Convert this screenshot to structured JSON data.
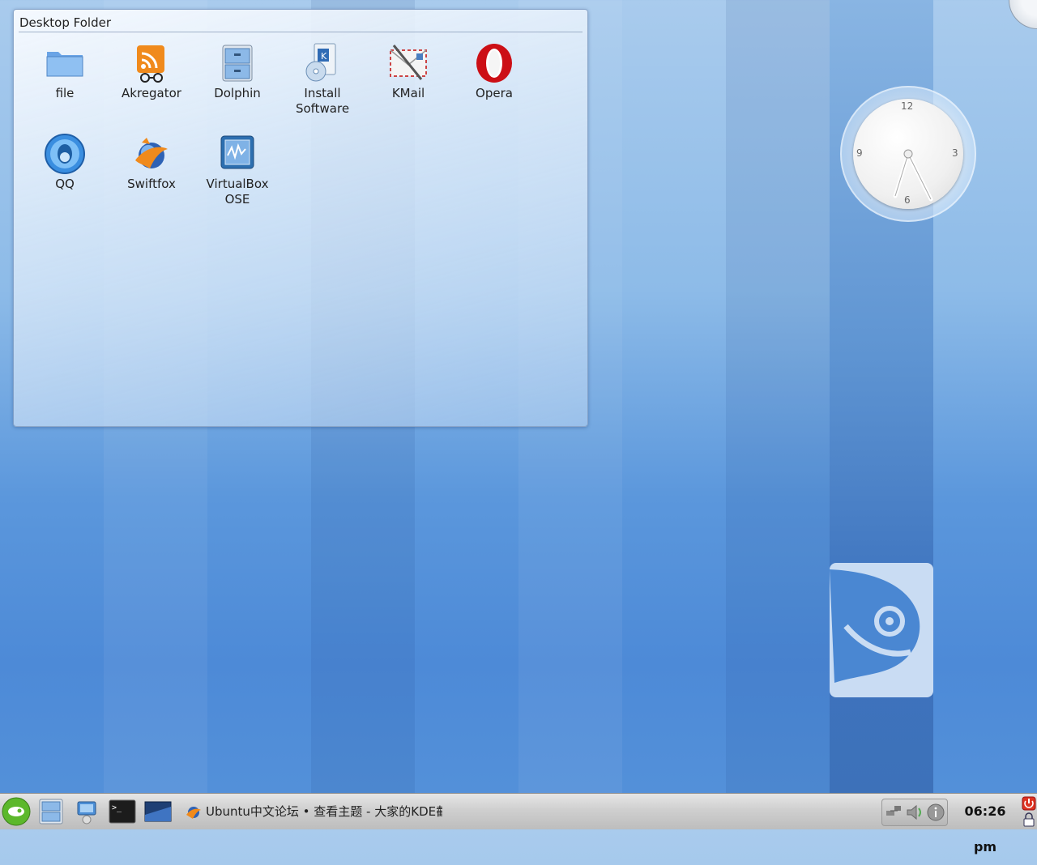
{
  "folder": {
    "title": "Desktop Folder",
    "items": [
      {
        "label": "file",
        "icon": "folder-icon"
      },
      {
        "label": "Akregator",
        "icon": "akregator-icon"
      },
      {
        "label": "Dolphin",
        "icon": "dolphin-icon"
      },
      {
        "label": "Install\nSoftware",
        "icon": "install-software-icon"
      },
      {
        "label": "KMail",
        "icon": "kmail-icon"
      },
      {
        "label": "Opera",
        "icon": "opera-icon"
      },
      {
        "label": "QQ",
        "icon": "qq-icon"
      },
      {
        "label": "Swiftfox",
        "icon": "swiftfox-icon"
      },
      {
        "label": "VirtualBox\nOSE",
        "icon": "virtualbox-icon"
      }
    ]
  },
  "clock_widget": {
    "numerals": {
      "twelve": "12",
      "three": "3",
      "six": "6",
      "nine": "9"
    }
  },
  "taskbar": {
    "task_title": "Ubuntu中文论坛 • 查看主题 - 大家的KDE截",
    "time": "06:26 pm"
  },
  "colors": {
    "wallpaper": "#5592da",
    "opera_red": "#cc0f16",
    "tray_bg": "#c8c8c8"
  }
}
